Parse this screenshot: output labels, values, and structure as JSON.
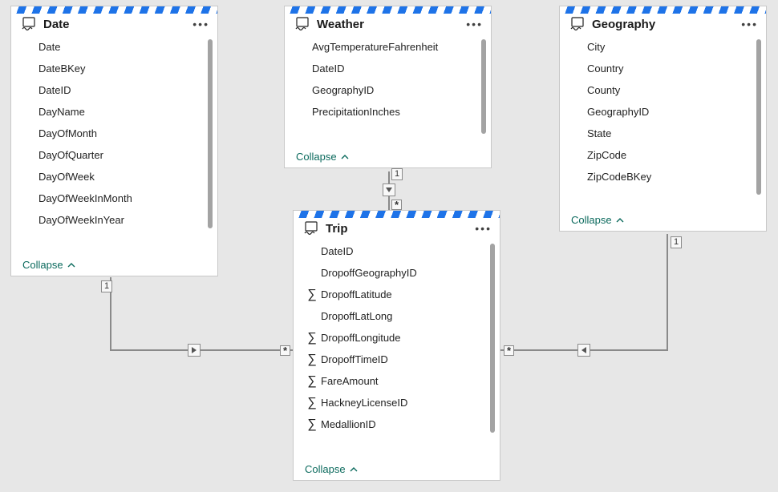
{
  "collapse_label": "Collapse",
  "tables": {
    "date": {
      "title": "Date",
      "fields": [
        {
          "name": "Date"
        },
        {
          "name": "DateBKey"
        },
        {
          "name": "DateID"
        },
        {
          "name": "DayName"
        },
        {
          "name": "DayOfMonth"
        },
        {
          "name": "DayOfQuarter"
        },
        {
          "name": "DayOfWeek"
        },
        {
          "name": "DayOfWeekInMonth"
        },
        {
          "name": "DayOfWeekInYear"
        }
      ]
    },
    "weather": {
      "title": "Weather",
      "fields": [
        {
          "name": "AvgTemperatureFahrenheit"
        },
        {
          "name": "DateID"
        },
        {
          "name": "GeographyID"
        },
        {
          "name": "PrecipitationInches"
        }
      ]
    },
    "geography": {
      "title": "Geography",
      "fields": [
        {
          "name": "City"
        },
        {
          "name": "Country"
        },
        {
          "name": "County"
        },
        {
          "name": "GeographyID"
        },
        {
          "name": "State"
        },
        {
          "name": "ZipCode"
        },
        {
          "name": "ZipCodeBKey"
        }
      ]
    },
    "trip": {
      "title": "Trip",
      "fields": [
        {
          "name": "DateID"
        },
        {
          "name": "DropoffGeographyID"
        },
        {
          "name": "DropoffLatitude",
          "agg": true
        },
        {
          "name": "DropoffLatLong"
        },
        {
          "name": "DropoffLongitude",
          "agg": true
        },
        {
          "name": "DropoffTimeID",
          "agg": true
        },
        {
          "name": "FareAmount",
          "agg": true
        },
        {
          "name": "HackneyLicenseID",
          "agg": true
        },
        {
          "name": "MedallionID",
          "agg": true
        }
      ]
    }
  },
  "relationships": {
    "weather_trip": {
      "from_card": "1",
      "to_card": "*"
    },
    "date_trip": {
      "from_card": "1",
      "to_card": "*"
    },
    "geography_trip": {
      "from_card": "1",
      "to_card": "*"
    }
  }
}
